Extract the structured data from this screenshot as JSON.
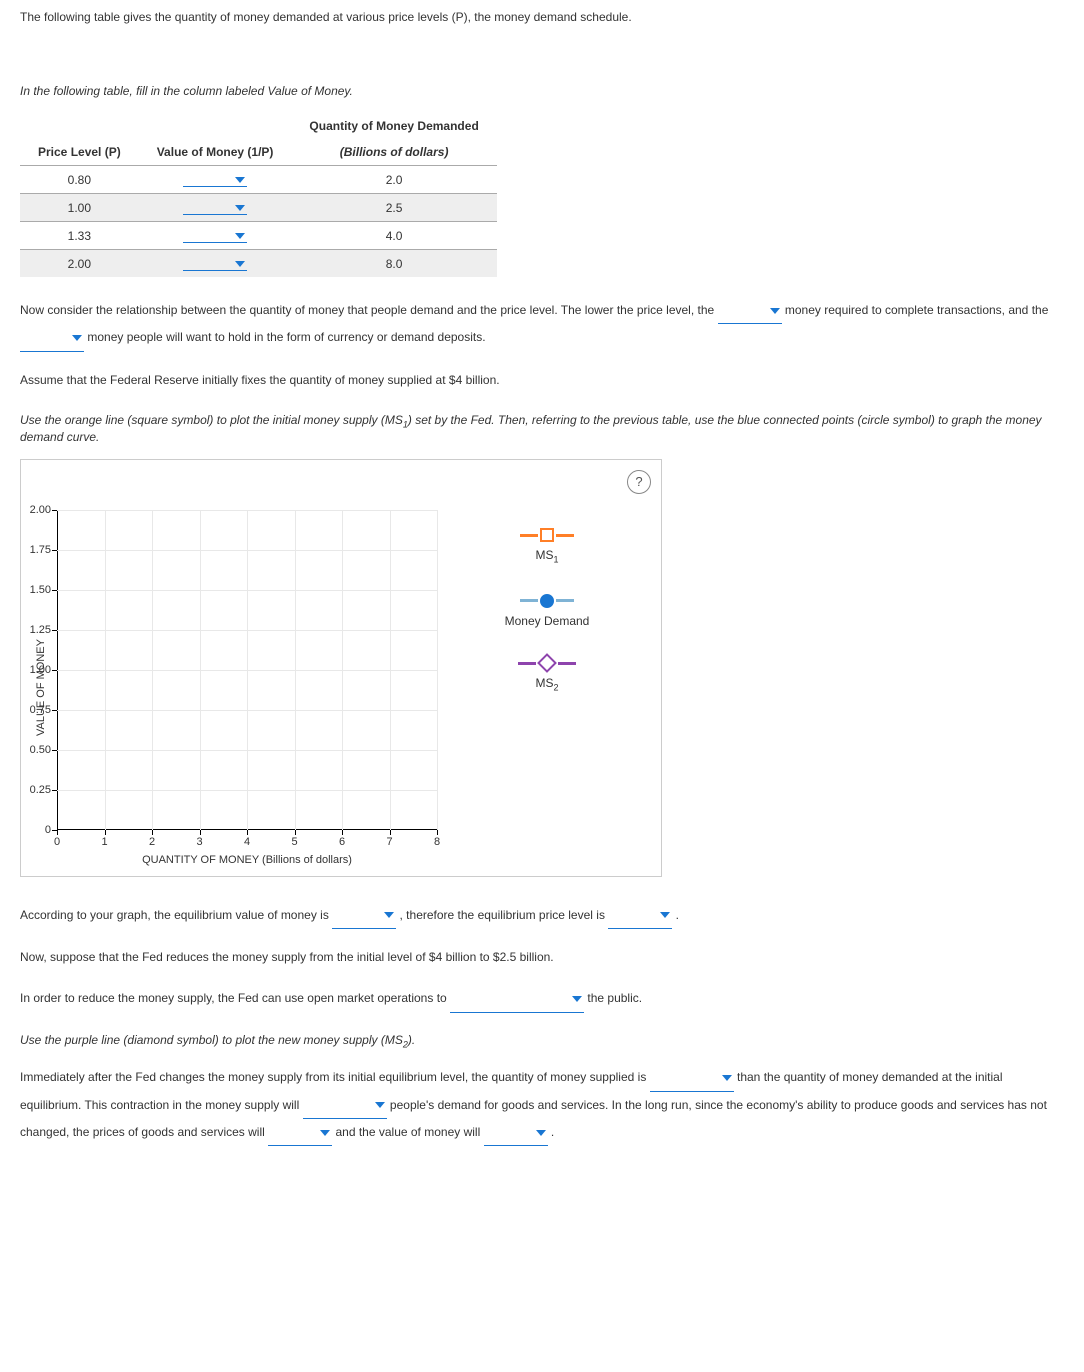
{
  "intro": "The following table gives the quantity of money demanded at various price levels (P), the money demand schedule.",
  "instr1": "In the following table, fill in the column labeled Value of Money.",
  "table": {
    "h1": "Price Level (P)",
    "h2": "Value of Money (1/P)",
    "h3a": "Quantity of Money Demanded",
    "h3b": "(Billions of dollars)",
    "rows": [
      {
        "p": "0.80",
        "q": "2.0"
      },
      {
        "p": "1.00",
        "q": "2.5"
      },
      {
        "p": "1.33",
        "q": "4.0"
      },
      {
        "p": "2.00",
        "q": "8.0"
      }
    ]
  },
  "para1a": "Now consider the relationship between the quantity of money that people demand and the price level. The lower the price level, the ",
  "para1b": " money required to complete transactions, and the ",
  "para1c": " money people will want to hold in the form of currency or demand deposits.",
  "para2": "Assume that the Federal Reserve initially fixes the quantity of money supplied at $4 billion.",
  "instr2a": "Use the orange line (square symbol) to plot the initial money supply (",
  "instr2b": ") set by the Fed. Then, referring to the previous table, use the blue connected points (circle symbol) to graph the money demand curve.",
  "ms1": "MS",
  "ms1sub": "1",
  "chart_data": {
    "type": "scatter",
    "title": "",
    "xlabel": "QUANTITY OF MONEY (Billions of dollars)",
    "ylabel": "VALUE OF MONEY",
    "xlim": [
      0,
      8
    ],
    "ylim": [
      0,
      2.0
    ],
    "xticks": [
      0,
      1,
      2,
      3,
      4,
      5,
      6,
      7,
      8
    ],
    "yticks": [
      0,
      0.25,
      0.5,
      0.75,
      1.0,
      1.25,
      1.5,
      1.75,
      2.0
    ],
    "series": []
  },
  "legend": {
    "ms1": "MS",
    "ms1sub": "1",
    "md": "Money Demand",
    "ms2": "MS",
    "ms2sub": "2"
  },
  "para3a": "According to your graph, the equilibrium value of money is ",
  "para3b": " , therefore the equilibrium price level is ",
  "para3c": " .",
  "para4": "Now, suppose that the Fed reduces the money supply from the initial level of $4 billion to $2.5 billion.",
  "para5a": "In order to reduce the money supply, the Fed can use open market operations to ",
  "para5b": " the public.",
  "instr3a": "Use the purple line (diamond symbol) to plot the new money supply (",
  "instr3b": ").",
  "ms2": "MS",
  "ms2sub": "2",
  "para6a": "Immediately after the Fed changes the money supply from its initial equilibrium level, the quantity of money supplied is ",
  "para6b": " than the quantity of money demanded at the initial equilibrium. This contraction in the money supply will ",
  "para6c": " people's demand for goods and services. In the long run, since the economy's ability to produce goods and services has not changed, the prices of goods and services will ",
  "para6d": " and the value of money will ",
  "para6e": " ."
}
